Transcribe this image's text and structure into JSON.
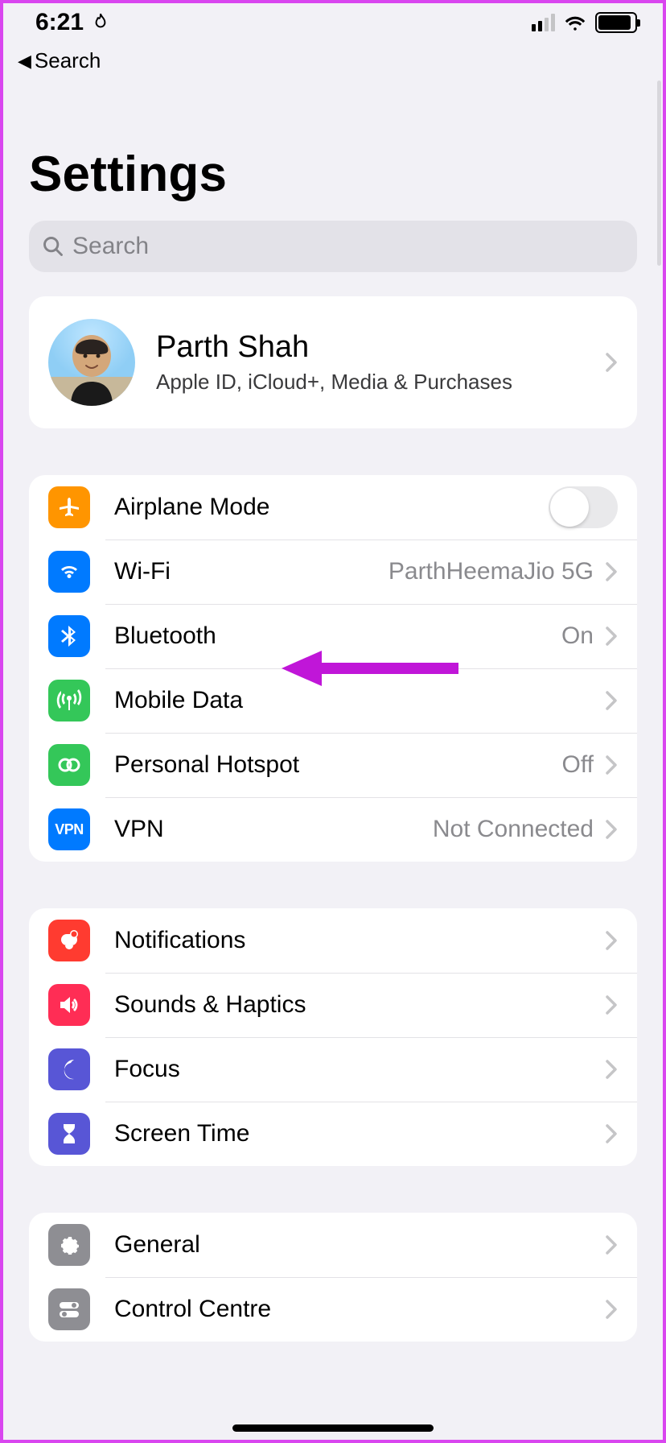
{
  "status": {
    "time": "6:21",
    "back_label": "Search"
  },
  "page": {
    "title": "Settings"
  },
  "search": {
    "placeholder": "Search"
  },
  "profile": {
    "name": "Parth Shah",
    "subtitle": "Apple ID, iCloud+, Media & Purchases"
  },
  "group1": {
    "airplane": "Airplane Mode",
    "wifi": "Wi-Fi",
    "wifi_value": "ParthHeemaJio 5G",
    "bluetooth": "Bluetooth",
    "bluetooth_value": "On",
    "mobile": "Mobile Data",
    "hotspot": "Personal Hotspot",
    "hotspot_value": "Off",
    "vpn": "VPN",
    "vpn_value": "Not Connected"
  },
  "group2": {
    "notifications": "Notifications",
    "sounds": "Sounds & Haptics",
    "focus": "Focus",
    "screentime": "Screen Time"
  },
  "group3": {
    "general": "General",
    "controlcentre": "Control Centre"
  }
}
